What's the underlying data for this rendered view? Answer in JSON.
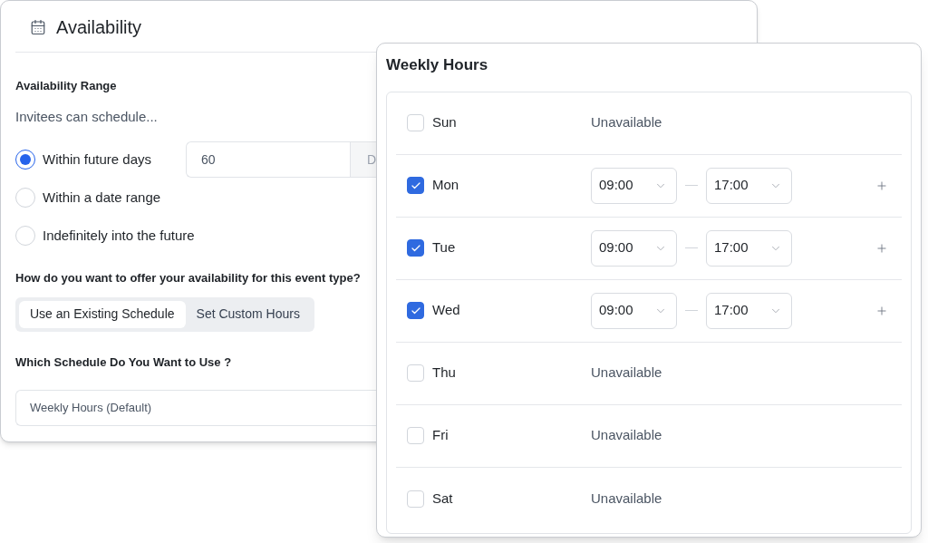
{
  "availability": {
    "title": "Availability",
    "range_label": "Availability Range",
    "intro": "Invitees can schedule...",
    "range_options": [
      {
        "label": "Within future days",
        "selected": true
      },
      {
        "label": "Within a date range",
        "selected": false
      },
      {
        "label": "Indefinitely into the future",
        "selected": false
      }
    ],
    "future_days": {
      "value": "60",
      "suffix": "D"
    },
    "offer_question": "How do you want to offer your availability for this event type?",
    "offer_options": [
      {
        "label": "Use an Existing Schedule",
        "selected": true
      },
      {
        "label": "Set Custom Hours",
        "selected": false
      }
    ],
    "schedule_question": "Which Schedule Do You Want to Use ?",
    "schedule_select": {
      "value": "Weekly Hours (Default)"
    }
  },
  "weekly_hours": {
    "title": "Weekly Hours",
    "days": [
      {
        "day": "Sun",
        "checked": false,
        "status": "Unavailable"
      },
      {
        "day": "Mon",
        "checked": true,
        "start": "09:00",
        "end": "17:00"
      },
      {
        "day": "Tue",
        "checked": true,
        "start": "09:00",
        "end": "17:00"
      },
      {
        "day": "Wed",
        "checked": true,
        "start": "09:00",
        "end": "17:00"
      },
      {
        "day": "Thu",
        "checked": false,
        "status": "Unavailable"
      },
      {
        "day": "Fri",
        "checked": false,
        "status": "Unavailable"
      },
      {
        "day": "Sat",
        "checked": false,
        "status": "Unavailable"
      }
    ]
  }
}
